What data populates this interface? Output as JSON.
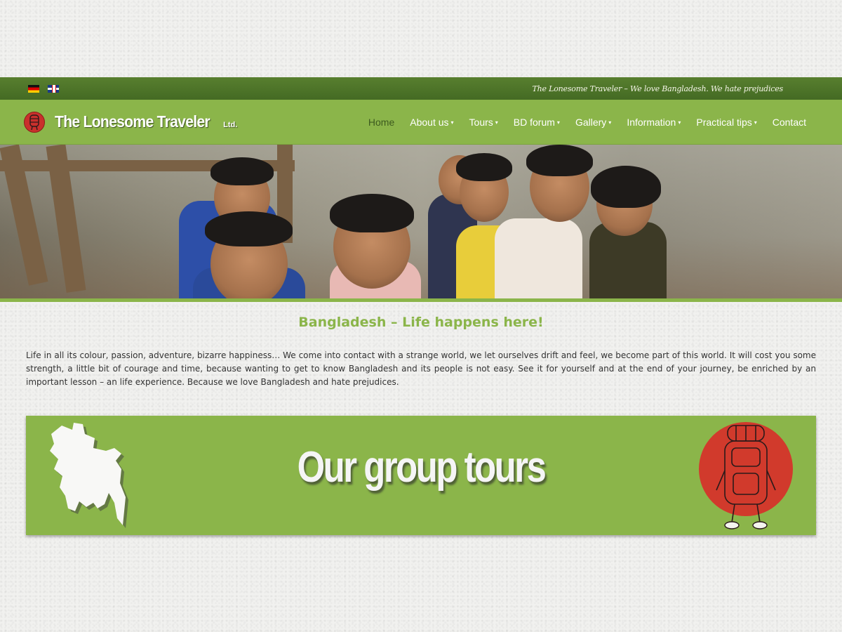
{
  "topbar": {
    "flags": [
      {
        "name": "German",
        "icon": "flag-de-icon"
      },
      {
        "name": "English",
        "icon": "flag-uk-icon"
      }
    ],
    "tagline": "The Lonesome Traveler – We love Bangladesh. We hate prejudices"
  },
  "header": {
    "logo_text": "The Lonesome Traveler",
    "logo_suffix": "Ltd.",
    "nav": [
      {
        "label": "Home",
        "active": true,
        "has_dropdown": false
      },
      {
        "label": "About us",
        "active": false,
        "has_dropdown": true
      },
      {
        "label": "Tours",
        "active": false,
        "has_dropdown": true
      },
      {
        "label": "BD forum",
        "active": false,
        "has_dropdown": true
      },
      {
        "label": "Gallery",
        "active": false,
        "has_dropdown": true
      },
      {
        "label": "Information",
        "active": false,
        "has_dropdown": true
      },
      {
        "label": "Practical tips",
        "active": false,
        "has_dropdown": true
      },
      {
        "label": "Contact",
        "active": false,
        "has_dropdown": false
      }
    ],
    "caret_glyph": "▾"
  },
  "main": {
    "headline": "Bangladesh – Life happens here!",
    "intro": "Life in all its colour, passion, adventure, bizarre happiness… We come into contact with a strange world, we let ourselves drift and feel, we become part of this world. It will cost you some strength, a little bit of courage and time, because wanting to get to know Bangladesh and its people is not easy. See it for yourself and at the end of your journey, be enriched by an important lesson – an life experience. Because we love Bangladesh and hate prejudices.",
    "banner": {
      "text": "Our group tours",
      "left_icon": "bangladesh-map-icon",
      "right_icon": "backpack-icon"
    }
  },
  "colors": {
    "accent_green": "#8bb54a",
    "dark_green": "#4f7629",
    "active_nav": "#3d5a1f",
    "red": "#d13a2c"
  }
}
